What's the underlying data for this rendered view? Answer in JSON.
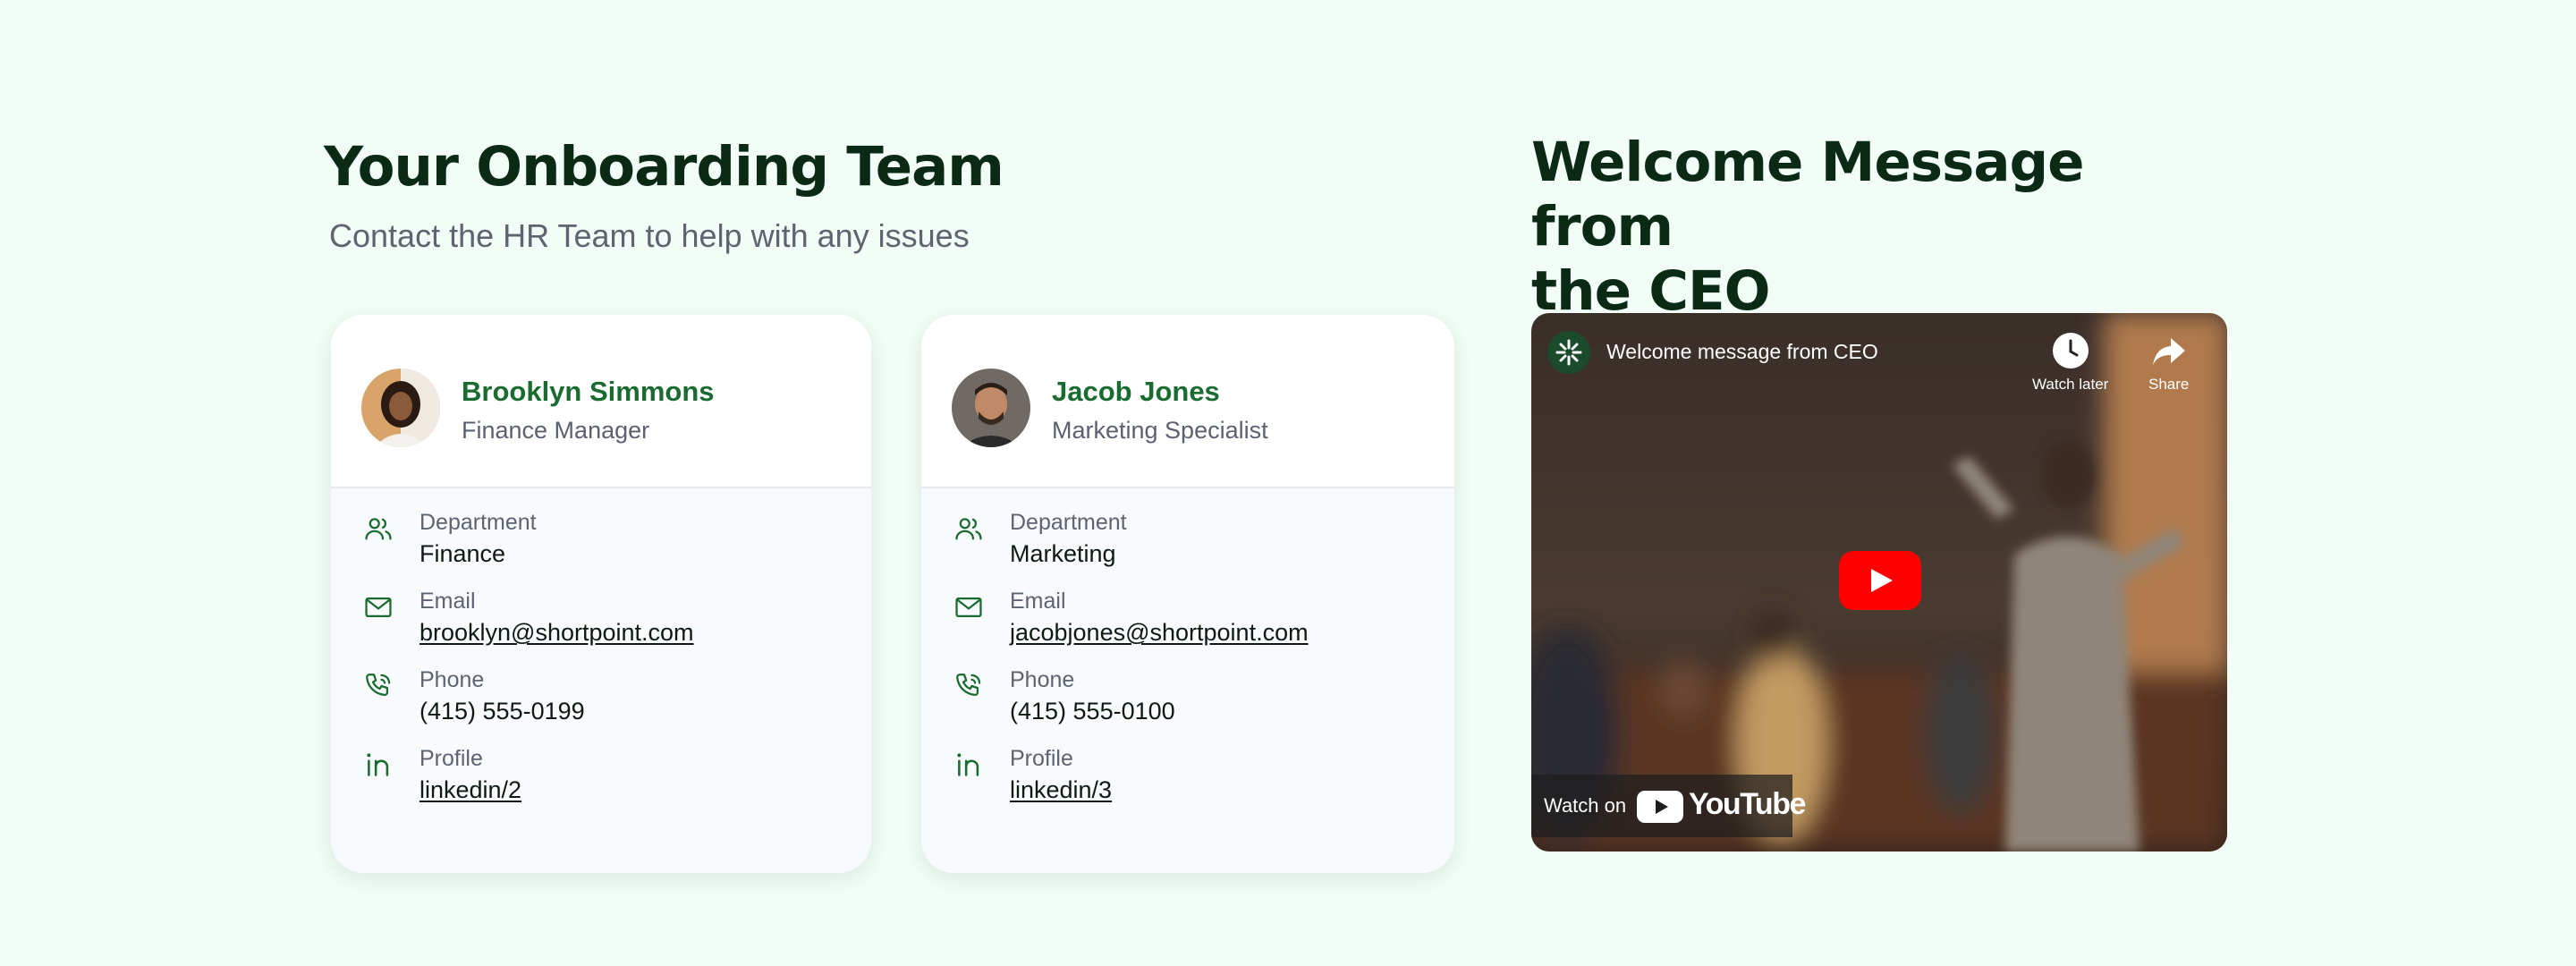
{
  "team_section": {
    "title": "Your Onboarding Team",
    "subtitle": "Contact the HR Team to help with any issues"
  },
  "cards": [
    {
      "name": "Brooklyn Simmons",
      "role": "Finance Manager",
      "fields": [
        {
          "label": "Department",
          "value": "Finance",
          "icon": "users-icon"
        },
        {
          "label": "Email",
          "value": "brooklyn@shortpoint.com",
          "icon": "mail-icon"
        },
        {
          "label": "Phone",
          "value": "(415) 555-0199",
          "icon": "phone-icon"
        },
        {
          "label": "Profile",
          "value": "linkedin/2",
          "icon": "linkedin-icon"
        }
      ]
    },
    {
      "name": "Jacob Jones",
      "role": "Marketing Specialist",
      "fields": [
        {
          "label": "Department",
          "value": "Marketing",
          "icon": "users-icon"
        },
        {
          "label": "Email",
          "value": "jacobjones@shortpoint.com",
          "icon": "mail-icon"
        },
        {
          "label": "Phone",
          "value": "(415) 555-0100",
          "icon": "phone-icon"
        },
        {
          "label": "Profile",
          "value": "linkedin/3",
          "icon": "linkedin-icon"
        }
      ]
    }
  ],
  "ceo_section": {
    "title_line1": "Welcome Message from",
    "title_line2": "the CEO"
  },
  "video": {
    "title": "Welcome message from CEO",
    "watch_later": "Watch later",
    "share": "Share",
    "watch_on": "Watch on",
    "brand": "YouTube"
  },
  "colors": {
    "background": "#f1fdf6",
    "heading": "#0b2a16",
    "accent_green": "#1a6b2f",
    "youtube_red": "#ff0000"
  }
}
